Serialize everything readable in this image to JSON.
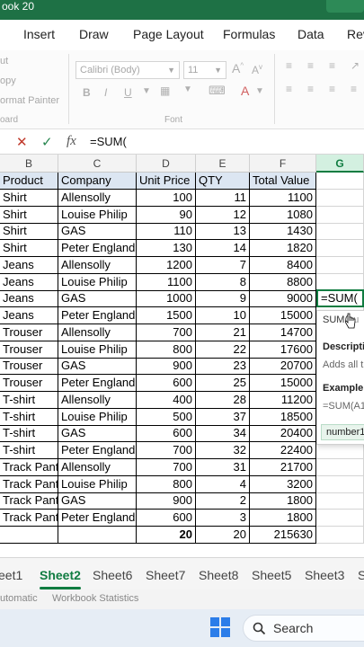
{
  "window": {
    "title_fragment": "ook 20"
  },
  "ribbon_tabs": [
    "Insert",
    "Draw",
    "Page Layout",
    "Formulas",
    "Data",
    "Rev"
  ],
  "clipboard": {
    "cut": "ut",
    "copy": "opy",
    "painter": "ormat Painter",
    "group": "oard"
  },
  "font": {
    "name": "Calibri (Body)",
    "size": "11",
    "group": "Font"
  },
  "formula_bar": {
    "fx": "fx",
    "text": "=SUM("
  },
  "columns": [
    "B",
    "C",
    "D",
    "E",
    "F",
    "G"
  ],
  "headers": [
    "Product",
    "Company",
    "Unit Price",
    "QTY",
    "Total Value"
  ],
  "rows": [
    [
      "Shirt",
      "Allensolly",
      "100",
      "11",
      "1100"
    ],
    [
      "Shirt",
      "Louise Philip",
      "90",
      "12",
      "1080"
    ],
    [
      "Shirt",
      "GAS",
      "110",
      "13",
      "1430"
    ],
    [
      "Shirt",
      "Peter England",
      "130",
      "14",
      "1820"
    ],
    [
      "Jeans",
      "Allensolly",
      "1200",
      "7",
      "8400"
    ],
    [
      "Jeans",
      "Louise Philip",
      "1100",
      "8",
      "8800"
    ],
    [
      "Jeans",
      "GAS",
      "1000",
      "9",
      "9000"
    ],
    [
      "Jeans",
      "Peter England",
      "1500",
      "10",
      "15000"
    ],
    [
      "Trouser",
      "Allensolly",
      "700",
      "21",
      "14700"
    ],
    [
      "Trouser",
      "Louise Philip",
      "800",
      "22",
      "17600"
    ],
    [
      "Trouser",
      "GAS",
      "900",
      "23",
      "20700"
    ],
    [
      "Trouser",
      "Peter England",
      "600",
      "25",
      "15000"
    ],
    [
      "T-shirt",
      "Allensolly",
      "400",
      "28",
      "11200"
    ],
    [
      "T-shirt",
      "Louise Philip",
      "500",
      "37",
      "18500"
    ],
    [
      "T-shirt",
      "GAS",
      "600",
      "34",
      "20400"
    ],
    [
      "T-shirt",
      "Peter England",
      "700",
      "32",
      "22400"
    ],
    [
      "Track Pant",
      "Allensolly",
      "700",
      "31",
      "21700"
    ],
    [
      "Track Pant",
      "Louise Philip",
      "800",
      "4",
      "3200"
    ],
    [
      "Track Pant",
      "GAS",
      "900",
      "2",
      "1800"
    ],
    [
      "Track Pant",
      "Peter England",
      "600",
      "3",
      "1800"
    ]
  ],
  "totals": {
    "unit_price": "20",
    "qty": "20",
    "total_value": "215630"
  },
  "editing_cell": {
    "text": "=SUM("
  },
  "autocomplete": {
    "fn": "SUM(",
    "fn_tail": "nu",
    "desc_label": "Descripti",
    "desc_text": "Adds all t",
    "example_label": "Example",
    "example_text": "=SUM(A1",
    "arg": "number1"
  },
  "sheet_tabs": [
    "eet1",
    "Sheet2",
    "Sheet6",
    "Sheet7",
    "Sheet8",
    "Sheet5",
    "Sheet3",
    "S"
  ],
  "active_sheet": "Sheet2",
  "status": {
    "calc": "utomatic",
    "stats": "Workbook Statistics"
  },
  "taskbar": {
    "search": "Search"
  },
  "colors": {
    "excel_green": "#107c41",
    "header_fill": "#dce6f2",
    "titlebar": "#1e7145"
  }
}
